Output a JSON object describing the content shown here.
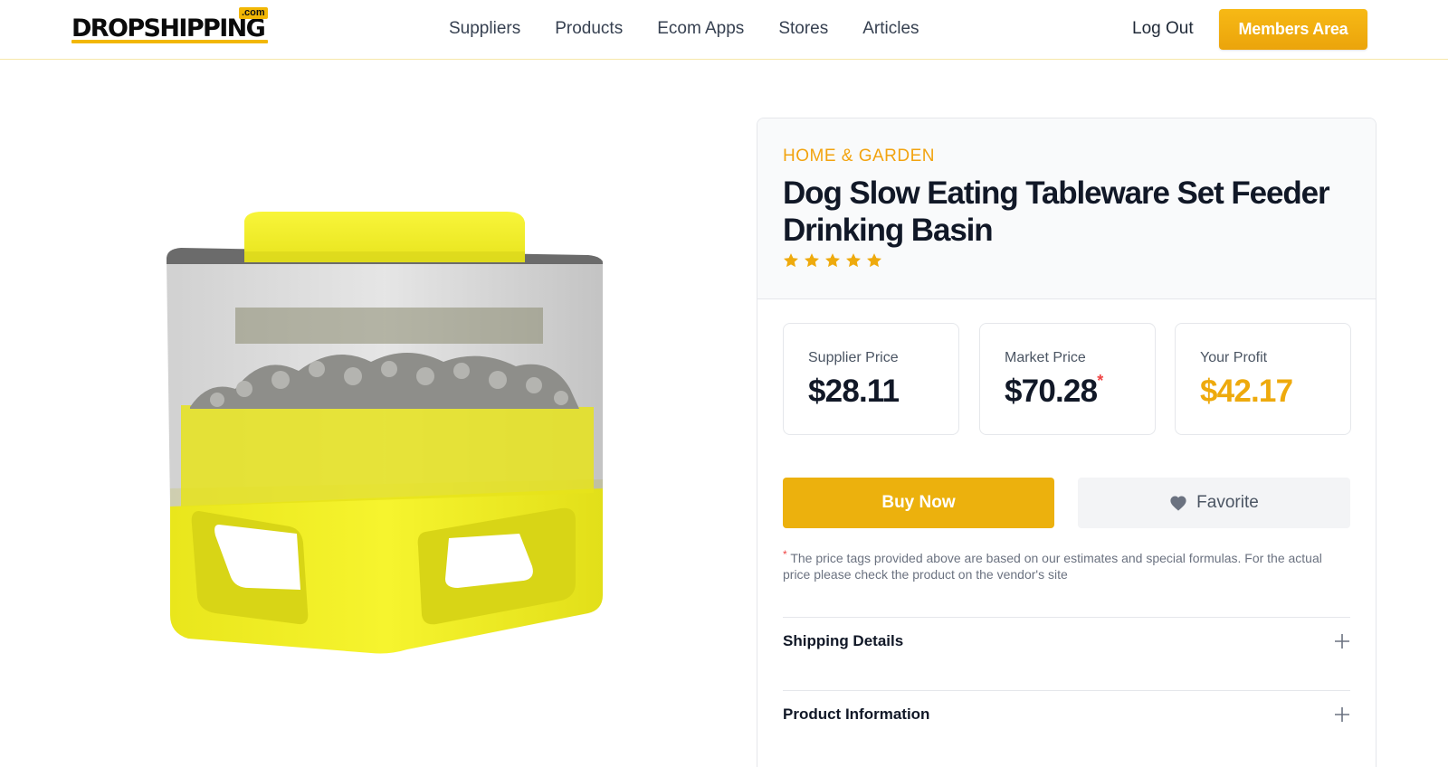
{
  "header": {
    "logo_text": "DROPSHIPPING",
    "logo_badge": ".com",
    "nav": [
      "Suppliers",
      "Products",
      "Ecom Apps",
      "Stores",
      "Articles"
    ],
    "logout_label": "Log Out",
    "members_label": "Members Area"
  },
  "product": {
    "category": "HOME & GARDEN",
    "title": "Dog Slow Eating Tableware Set Feeder Drinking Basin",
    "rating": 5,
    "prices": {
      "supplier_label": "Supplier Price",
      "supplier_value": "$28.11",
      "market_label": "Market Price",
      "market_value": "$70.28",
      "market_asterisk": "*",
      "profit_label": "Your Profit",
      "profit_value": "$42.17"
    },
    "buy_label": "Buy Now",
    "favorite_label": "Favorite",
    "disclaimer_asterisk": "*",
    "disclaimer": "The price tags provided above are based on our estimates and special formulas. For the actual price please check the product on the vendor's site",
    "accordion": [
      "Shipping Details",
      "Product Information"
    ]
  },
  "colors": {
    "accent": "#ecb10d",
    "category": "#f2a30f",
    "profit": "#eeaa0d",
    "asterisk": "#ef4444"
  },
  "icons": {
    "rating": "star-icon",
    "favorite": "heart-icon",
    "accordion": "plus-icon"
  }
}
